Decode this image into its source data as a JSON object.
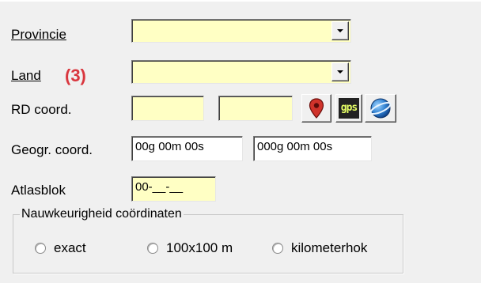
{
  "form": {
    "provincie": {
      "label": "Provincie",
      "value": ""
    },
    "land": {
      "label": "Land",
      "value": "",
      "annotation": "(3)"
    },
    "rd_coord": {
      "label": "RD coord.",
      "x": "",
      "y": ""
    },
    "geogr_coord": {
      "label": "Geogr. coord.",
      "lat": "00g 00m 00s",
      "lon": "000g 00m 00s"
    },
    "atlasblok": {
      "label": "Atlasblok",
      "value": "00-__-__"
    },
    "accuracy": {
      "legend": "Nauwkeurigheid coördinaten",
      "options": [
        "exact",
        "100x100 m",
        "kilometerhok"
      ]
    }
  },
  "icons": [
    "map-pin-icon",
    "gps-icon",
    "globe-icon"
  ],
  "colors": {
    "field_bg": "#ffffc4",
    "annotation": "#d9363e",
    "panel_bg": "#f0f0f0"
  }
}
